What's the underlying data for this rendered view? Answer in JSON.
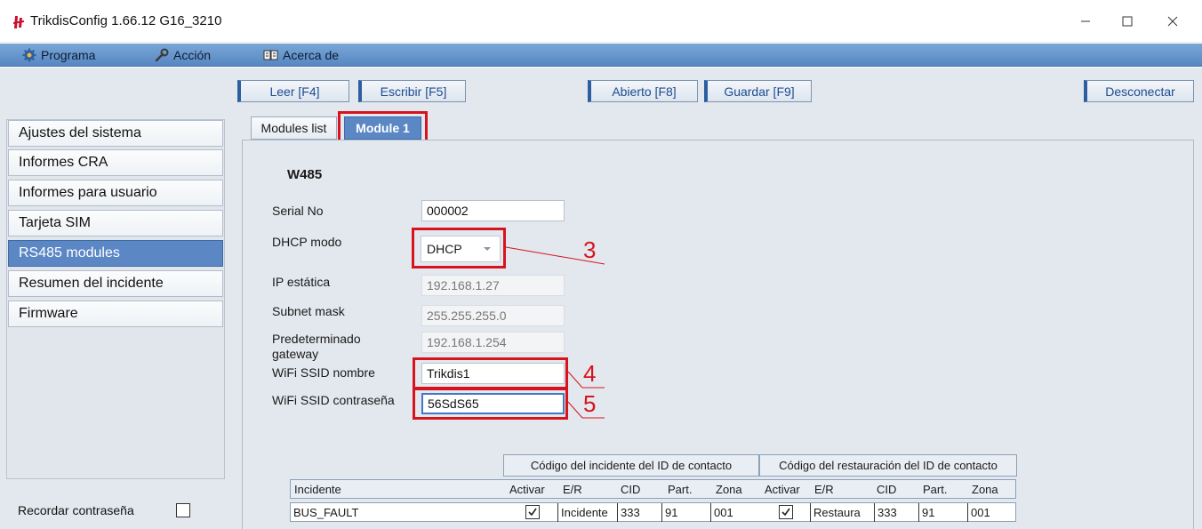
{
  "window": {
    "title": "TrikdisConfig 1.66.12  G16_3210"
  },
  "menu": {
    "items": [
      {
        "label": "Programa",
        "icon": "gear-icon"
      },
      {
        "label": "Acción",
        "icon": "wrench-icon"
      },
      {
        "label": "Acerca de",
        "icon": "book-icon"
      }
    ]
  },
  "toolbar": {
    "read": "Leer [F4]",
    "write": "Escribir [F5]",
    "open": "Abierto [F8]",
    "save": "Guardar [F9]",
    "disconnect": "Desconectar"
  },
  "sidebar": {
    "items": [
      {
        "label": "Ajustes del sistema"
      },
      {
        "label": "Informes CRA"
      },
      {
        "label": "Informes para usuario"
      },
      {
        "label": "Tarjeta SIM"
      },
      {
        "label": "RS485 modules"
      },
      {
        "label": "Resumen del incidente"
      },
      {
        "label": "Firmware"
      }
    ],
    "remember_label": "Recordar contraseña"
  },
  "tabs": [
    {
      "label": "Modules list"
    },
    {
      "label": "Module 1"
    }
  ],
  "module": {
    "title": "W485",
    "serial_label": "Serial No",
    "serial_value": "000002",
    "dhcp_label": "DHCP modo",
    "dhcp_value": "DHCP",
    "ip_label": "IP estática",
    "ip_value": "192.168.1.27",
    "mask_label": "Subnet mask",
    "mask_value": "255.255.255.0",
    "gateway_label": "Predeterminado gateway",
    "gateway_value": "192.168.1.254",
    "ssid_label": "WiFi SSID nombre",
    "ssid_value": "Trikdis1",
    "pass_label": "WiFi SSID contraseña",
    "pass_value": "56SdS65"
  },
  "callouts": [
    "3",
    "4",
    "5"
  ],
  "table": {
    "group_incident": "Código del incidente del ID de contacto",
    "group_restore": "Código del restauración del ID de contacto",
    "headers": [
      "Incidente",
      "Activar",
      "E/R",
      "CID",
      "Part.",
      "Zona",
      "Activar",
      "E/R",
      "CID",
      "Part.",
      "Zona"
    ],
    "rows": [
      {
        "incident": "BUS_FAULT",
        "activate": true,
        "er": "Incidente",
        "cid": "333",
        "part": "91",
        "zone": "001",
        "r_activate": true,
        "r_er": "Restaura",
        "r_cid": "333",
        "r_part": "91",
        "r_zone": "001"
      }
    ]
  }
}
